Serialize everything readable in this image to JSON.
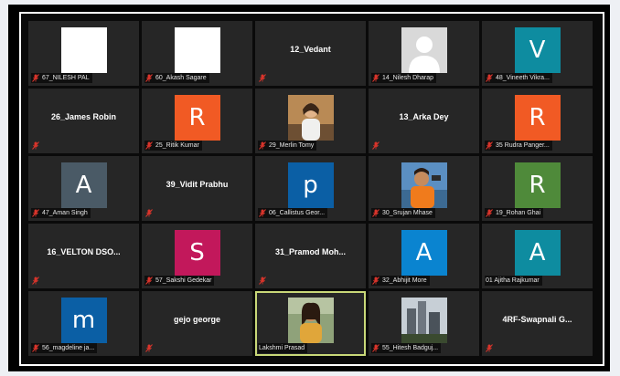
{
  "colors": {
    "tile": "#262626",
    "orange": "#f15a24",
    "teal": "#0e8ca0",
    "slate": "#4a5a66",
    "blue": "#0b5fa5",
    "green": "#4f8a3a",
    "pink": "#c2185b",
    "azure": "#0a84d0",
    "active_border": "#c9d878",
    "muted_icon": "#d9342b"
  },
  "tiles": [
    {
      "kind": "white",
      "label": "67_NILESH PAL"
    },
    {
      "kind": "white",
      "label": "60_Akash Sagare"
    },
    {
      "kind": "name",
      "center": "12_Vedant",
      "label": ""
    },
    {
      "kind": "placeholder",
      "label": "14_Nilesh Dharap"
    },
    {
      "kind": "letter",
      "letter": "V",
      "color": "teal",
      "label": "48_Vineeth Vikra..."
    },
    {
      "kind": "name",
      "center": "26_James Robin",
      "label": ""
    },
    {
      "kind": "letter",
      "letter": "R",
      "color": "orange",
      "label": "25_Ritik Kumar"
    },
    {
      "kind": "photo",
      "photo": "girl",
      "label": "29_Merlin Tomy"
    },
    {
      "kind": "name",
      "center": "13_Arka Dey",
      "label": ""
    },
    {
      "kind": "letter",
      "letter": "R",
      "color": "orange",
      "label": "35 Rudra Panger..."
    },
    {
      "kind": "letter",
      "letter": "A",
      "color": "slate",
      "label": "47_Aman Singh"
    },
    {
      "kind": "name",
      "center": "39_Vidit Prabhu",
      "label": ""
    },
    {
      "kind": "letter",
      "letter": "p",
      "color": "blue",
      "label": "06_Callistus Geor..."
    },
    {
      "kind": "photo",
      "photo": "boy",
      "label": "30_Srujan Mhase"
    },
    {
      "kind": "letter",
      "letter": "R",
      "color": "green",
      "label": "19_Rohan Ghai"
    },
    {
      "kind": "name",
      "center": "16_VELTON  DSO...",
      "label": ""
    },
    {
      "kind": "letter",
      "letter": "S",
      "color": "pink",
      "label": "57_Sakshi Gedekar"
    },
    {
      "kind": "name",
      "center": "31_Pramod  Moh...",
      "label": ""
    },
    {
      "kind": "letter",
      "letter": "A",
      "color": "azure",
      "label": "32_Abhijit More"
    },
    {
      "kind": "letter",
      "letter": "A",
      "color": "teal",
      "label": "01 Ajitha Rajkumar",
      "nomic": true
    },
    {
      "kind": "letter",
      "letter": "m",
      "color": "blue",
      "label": "56_magdeline ja..."
    },
    {
      "kind": "name",
      "center": "gejo george",
      "label": ""
    },
    {
      "kind": "photo",
      "photo": "woman",
      "label": "Lakshmi Prasad",
      "active": true,
      "nomic": true
    },
    {
      "kind": "photo",
      "photo": "city",
      "label": "55_Hitesh Badguj..."
    },
    {
      "kind": "name",
      "center": "4RF-Swapnali  G...",
      "label": ""
    }
  ]
}
